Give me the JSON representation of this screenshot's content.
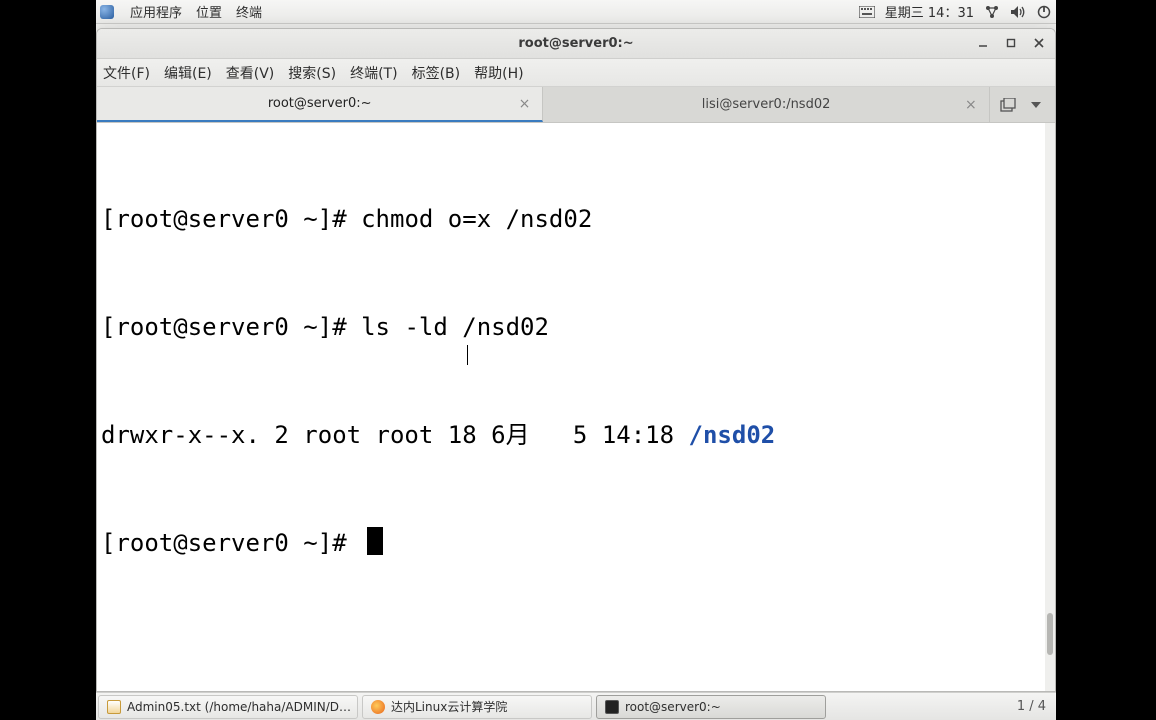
{
  "panel": {
    "apps": "应用程序",
    "places": "位置",
    "terminal": "终端",
    "datetime": "星期三 14：31"
  },
  "window": {
    "title": "root@server0:~",
    "menu": {
      "file": "文件(F)",
      "edit": "编辑(E)",
      "view": "查看(V)",
      "search": "搜索(S)",
      "terminal": "终端(T)",
      "tabs": "标签(B)",
      "help": "帮助(H)"
    },
    "tabs": {
      "0": {
        "label": "root@server0:~"
      },
      "1": {
        "label": "lisi@server0:/nsd02"
      }
    }
  },
  "terminal": {
    "line1_prompt": "[root@server0 ~]# ",
    "line1_cmd": "chmod o=x /nsd02",
    "line2_prompt": "[root@server0 ~]# ",
    "line2_cmd": "ls -ld /nsd02",
    "line3_perm": "drwxr-x--x. 2 root root 18 6月   5 14:18 ",
    "line3_path": "/nsd02",
    "line4_prompt": "[root@server0 ~]# "
  },
  "taskbar": {
    "item1": "Admin05.txt (/home/haha/ADMIN/D…",
    "item2": "达内Linux云计算学院",
    "item3": "root@server0:~",
    "pages": "1 / 4"
  }
}
